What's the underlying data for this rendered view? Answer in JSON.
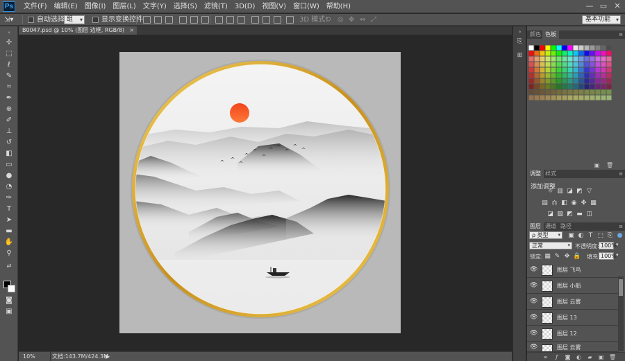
{
  "app": {
    "logo": "Ps"
  },
  "menu": [
    "文件(F)",
    "编辑(E)",
    "图像(I)",
    "图层(L)",
    "文字(Y)",
    "选择(S)",
    "滤镜(T)",
    "3D(D)",
    "视图(V)",
    "窗口(W)",
    "帮助(H)"
  ],
  "window_controls": {
    "minimize": "—",
    "restore": "▭",
    "close": "✕"
  },
  "options_bar": {
    "auto_select_label": "自动选择：",
    "auto_select_value": "组",
    "show_transform_label": "显示变换控件",
    "mode_3d_label": "3D 模式：",
    "workspace": "基本功能"
  },
  "document": {
    "tab_title": "B0047.psd @ 10% (图层 边框, RGB/8)",
    "tab_close": "×",
    "zoom": "10%",
    "doc_info": "文档:143.7M/424.3M",
    "status_arrow": "▶"
  },
  "panels": {
    "color_tabs": [
      "颜色",
      "色板"
    ],
    "adjust_tabs": [
      "调整",
      "样式"
    ],
    "adjust_title": "添加调整",
    "layers_tabs": [
      "图层",
      "通道",
      "路径"
    ],
    "filter_kind": "ρ 类型",
    "blend_mode": "正常",
    "opacity_label": "不透明度:",
    "opacity_value": "100%",
    "lock_label": "锁定:",
    "fill_label": "填充:",
    "fill_value": "100%"
  },
  "layers": [
    {
      "name": "图层 飞鸟"
    },
    {
      "name": "图层 小船"
    },
    {
      "name": "图层 云雾"
    },
    {
      "name": "图层 13"
    },
    {
      "name": "图层 12"
    },
    {
      "name": "图层 云雾"
    }
  ],
  "colors": {
    "accent_blue": "#2f8ee0",
    "sun_red": "#f0451b",
    "frame_gold": "#d4a22b"
  }
}
